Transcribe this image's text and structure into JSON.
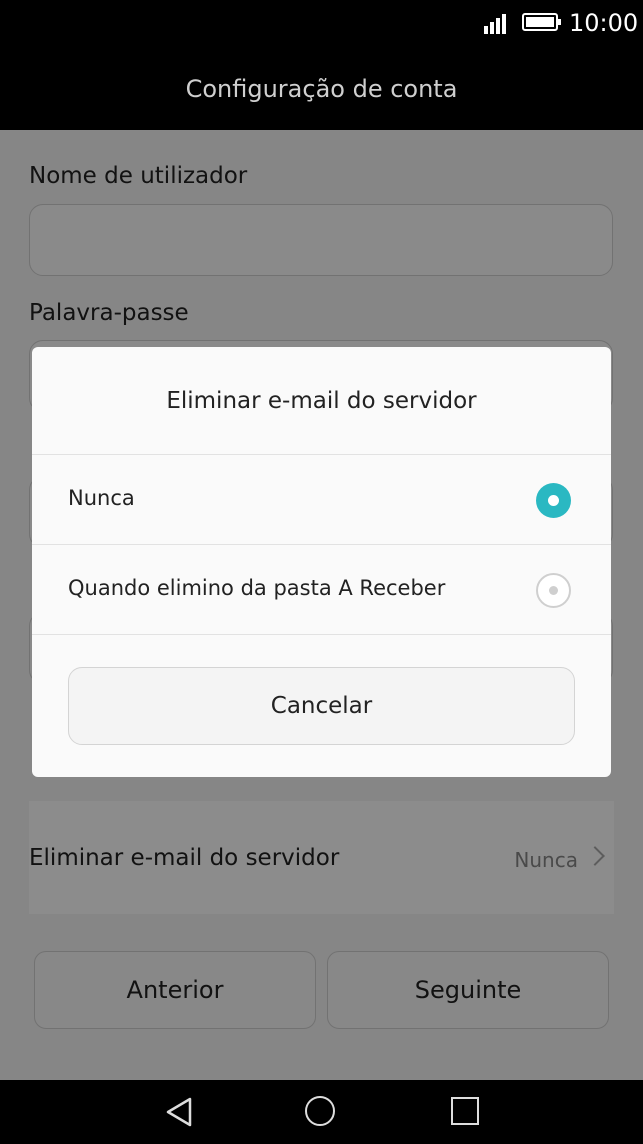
{
  "status_bar": {
    "time": "10:00",
    "signal_icon": "signal-icon",
    "battery_icon": "battery-icon"
  },
  "header": {
    "title": "Configuração de conta"
  },
  "form": {
    "username_label": "Nome de utilizador",
    "username_value": "",
    "password_label": "Palavra-passe",
    "password_value": "",
    "delete_row": {
      "label": "Eliminar e-mail do servidor",
      "value": "Nunca"
    }
  },
  "footer_buttons": {
    "previous": "Anterior",
    "next": "Seguinte"
  },
  "dialog": {
    "title": "Eliminar e-mail do servidor",
    "options": [
      {
        "label": "Nunca",
        "selected": true
      },
      {
        "label": "Quando elimino da pasta A Receber",
        "selected": false
      }
    ],
    "cancel": "Cancelar",
    "accent_color": "#2ab8c2"
  },
  "nav_bar": {
    "icons": [
      "back-icon",
      "home-icon",
      "recents-icon"
    ]
  }
}
